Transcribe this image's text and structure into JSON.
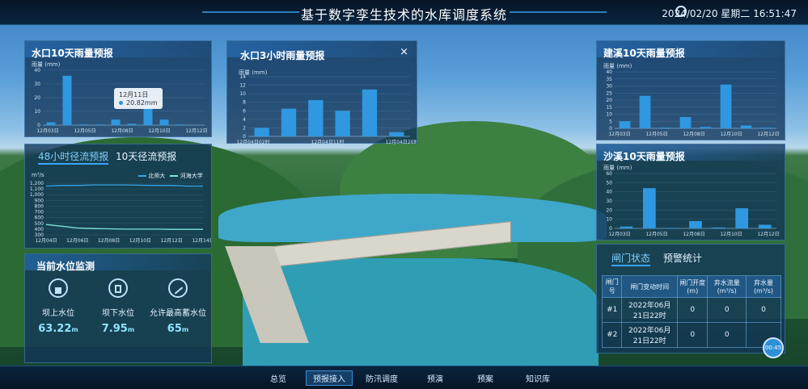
{
  "header": {
    "title": "基于数字孪生技术的水库调度系统",
    "datetime": "2024/02/20 星期二 16:51:47",
    "weather_icon": "partly-cloudy-icon"
  },
  "panel_rain_shuikou": {
    "title": "水口10天雨量预报",
    "unit": "雨量 (mm)",
    "tooltip_date": "12月11日",
    "tooltip_value": "20.82mm"
  },
  "panel_rain_3h": {
    "title": "水口3小时雨量预报",
    "unit": "雨量 (mm)",
    "close_label": "×"
  },
  "panel_flow": {
    "tab_48h": "48小时径流预报",
    "tab_10d": "10天径流预报",
    "unit": "m³/s",
    "legend": [
      "北师大",
      "河海大学"
    ]
  },
  "panel_water_level": {
    "title": "当前水位监测",
    "items": [
      {
        "label": "坝上水位",
        "value": "63.22",
        "unit": "m",
        "icon": "reservoir-level-icon"
      },
      {
        "label": "坝下水位",
        "value": "7.95",
        "unit": "m",
        "icon": "downstream-level-icon"
      },
      {
        "label": "允许最高蓄水位",
        "value": "65",
        "unit": "m",
        "icon": "max-level-icon"
      }
    ]
  },
  "panel_rain_jianxi": {
    "title": "建溪10天雨量预报",
    "unit": "雨量 (mm)"
  },
  "panel_rain_shaxi": {
    "title": "沙溪10天雨量预报",
    "unit": "雨量 (mm)"
  },
  "panel_gate": {
    "tab_gate": "闸门状态",
    "tab_alarm": "预警统计",
    "columns": [
      "闸门号",
      "闸门变动时间",
      "闸门开度(m)",
      "弃水流量(m³/s)",
      "弃水量(m³/s)"
    ],
    "rows": [
      {
        "no": "#1",
        "time": "2022年06月21日22时",
        "open": "0",
        "flow": "0",
        "vol": "0"
      },
      {
        "no": "#2",
        "time": "2022年06月21日22时",
        "open": "0",
        "flow": "0",
        "vol": ""
      }
    ],
    "clock_label": "00:45"
  },
  "bottom_nav": {
    "items": [
      "总览",
      "预报接入",
      "防汛调度",
      "预演",
      "预案",
      "知识库"
    ],
    "active": "预报接入"
  },
  "chart_data": [
    {
      "type": "bar",
      "title": "水口10天雨量预报",
      "ylabel": "雨量 (mm)",
      "ylim": [
        0,
        40
      ],
      "yticks": [
        0,
        10,
        20,
        30,
        40
      ],
      "xticks": [
        "12月03日",
        "12月05日",
        "12月08日",
        "12月10日",
        "12月12日"
      ],
      "values": [
        2,
        36,
        0.5,
        0.5,
        4,
        1,
        20.82,
        4,
        0.5,
        0
      ]
    },
    {
      "type": "bar",
      "title": "水口3小时雨量预报",
      "ylabel": "雨量 (mm)",
      "ylim": [
        0,
        14
      ],
      "yticks": [
        0,
        2,
        4,
        6,
        8,
        10,
        12,
        14
      ],
      "xticks": [
        "12月04日02时",
        "12月04日11时",
        "12月04日20时"
      ],
      "values": [
        2,
        6.5,
        8.5,
        6,
        11,
        1
      ]
    },
    {
      "type": "line",
      "title": "48小时径流预报",
      "ylabel": "m³/s",
      "ylim": [
        300,
        1200
      ],
      "yticks": [
        300,
        400,
        500,
        600,
        700,
        800,
        900,
        1000,
        1100,
        1200
      ],
      "ytick_labels": [
        "300",
        "400",
        "500",
        "600",
        "700",
        "800",
        "900",
        "1,000",
        "1,100",
        "1,200"
      ],
      "xticks": [
        "12月04日",
        "12月06日",
        "12月08日",
        "12月10日",
        "12月12日",
        "12月14日"
      ],
      "series": [
        {
          "name": "北师大",
          "values": [
            1150,
            1160,
            1160,
            1170,
            1170,
            1170,
            1165,
            1160,
            1160,
            1150,
            1150
          ]
        },
        {
          "name": "河海大学",
          "values": [
            480,
            450,
            420,
            410,
            405,
            400,
            400,
            400,
            395,
            395,
            395
          ]
        }
      ]
    },
    {
      "type": "bar",
      "title": "建溪10天雨量预报",
      "ylabel": "雨量 (mm)",
      "ylim": [
        0,
        40
      ],
      "yticks": [
        0,
        5,
        10,
        15,
        20,
        25,
        30,
        35,
        40
      ],
      "xticks": [
        "12月03日",
        "12月05日",
        "12月08日",
        "12月10日",
        "12月12日"
      ],
      "values": [
        5,
        23,
        0.5,
        8,
        1,
        31,
        2,
        0.5
      ]
    },
    {
      "type": "bar",
      "title": "沙溪10天雨量预报",
      "ylabel": "雨量 (mm)",
      "ylim": [
        0,
        60
      ],
      "yticks": [
        0,
        10,
        20,
        30,
        40,
        50,
        60
      ],
      "xticks": [
        "12月03日",
        "12月05日",
        "12月08日",
        "12月10日",
        "12月12日"
      ],
      "values": [
        2,
        44,
        0.5,
        8,
        1,
        22,
        4
      ]
    }
  ]
}
